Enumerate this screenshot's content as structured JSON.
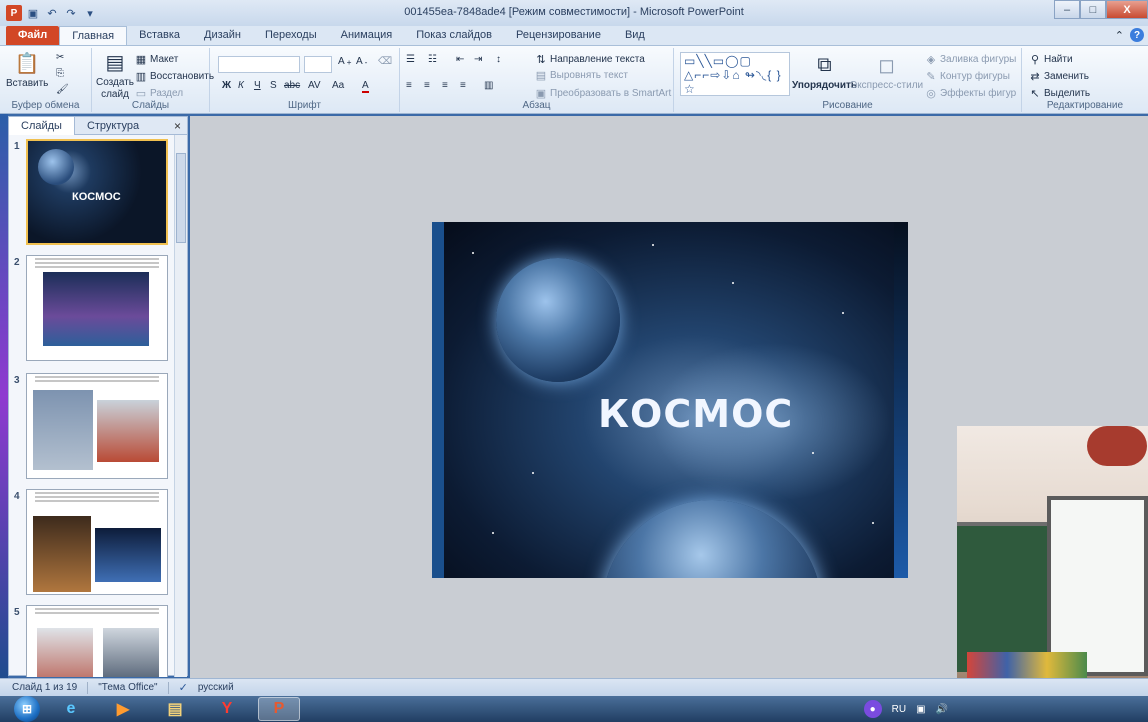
{
  "window": {
    "title": "001455ea-7848ade4 [Режим совместимости] - Microsoft PowerPoint",
    "app_icon": "P",
    "qat": [
      "save-icon",
      "undo-icon",
      "redo-icon",
      "customize-icon"
    ],
    "controls": {
      "minimize": "–",
      "maximize": "□",
      "close": "X"
    }
  },
  "ribbon_tabs": [
    "Файл",
    "Главная",
    "Вставка",
    "Дизайн",
    "Переходы",
    "Анимация",
    "Показ слайдов",
    "Рецензирование",
    "Вид"
  ],
  "ribbon": {
    "clipboard": {
      "paste": "Вставить",
      "label": "Буфер обмена"
    },
    "slides": {
      "create": "Создать",
      "slide": "слайд",
      "layout": "Макет",
      "reset": "Восстановить",
      "section": "Раздел",
      "label": "Слайды"
    },
    "font": {
      "label": "Шрифт",
      "bold": "Ж",
      "italic": "К",
      "underline": "Ч",
      "strike": "S",
      "abc": "abc",
      "spacing": "AV",
      "case": "Aa",
      "color": "A"
    },
    "paragraph": {
      "text_direction": "Направление текста",
      "align_text": "Выровнять текст",
      "smartart": "Преобразовать в SmartArt",
      "label": "Абзац"
    },
    "drawing": {
      "arrange": "Упорядочить",
      "quick_styles": "Экспресс-стили",
      "fill": "Заливка фигуры",
      "outline": "Контур фигуры",
      "effects": "Эффекты фигур",
      "label": "Рисование",
      "shapes": "▭╲╲▭◯▢\n△⌐⌐⇨⇩⌂\n↬◝◟{ }☆"
    },
    "editing": {
      "find": "Найти",
      "replace": "Заменить",
      "select": "Выделить",
      "label": "Редактирование"
    }
  },
  "left_panel": {
    "tabs": [
      "Слайды",
      "Структура"
    ],
    "close": "×",
    "slides": [
      {
        "num": "1",
        "title": "КОСМОС"
      },
      {
        "num": "2"
      },
      {
        "num": "3"
      },
      {
        "num": "4"
      },
      {
        "num": "5"
      }
    ]
  },
  "slide": {
    "title": "КОСМОС"
  },
  "status": {
    "slide_info": "Слайд 1 из 19",
    "theme": "\"Тема Office\"",
    "language": "русский"
  },
  "taskbar": {
    "lang": "RU",
    "apps": [
      "start",
      "ie",
      "media",
      "explorer",
      "yandex",
      "powerpoint"
    ]
  }
}
